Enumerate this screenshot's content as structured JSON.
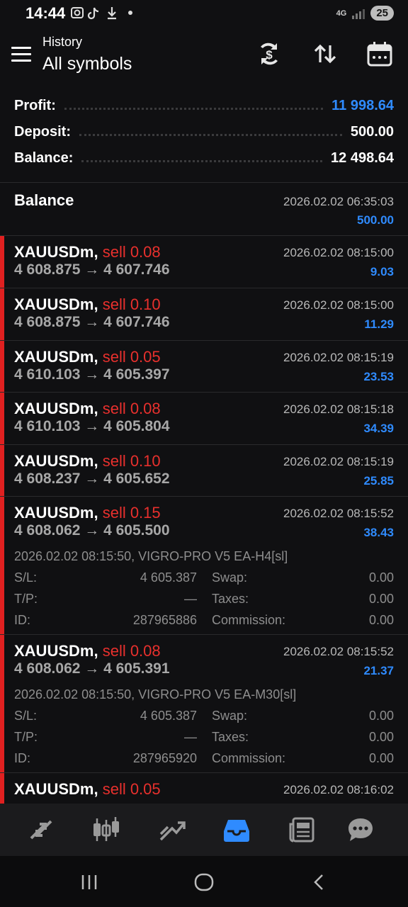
{
  "status": {
    "time": "14:44",
    "battery": "25",
    "network": "4G"
  },
  "header": {
    "subtitle": "History",
    "title": "All symbols"
  },
  "summary": [
    {
      "label": "Profit:",
      "value": "11 998.64",
      "color": "#2f8bff"
    },
    {
      "label": "Deposit:",
      "value": "500.00",
      "color": "#ffffff"
    },
    {
      "label": "Balance:",
      "value": "12 498.64",
      "color": "#ffffff"
    }
  ],
  "balance_entry": {
    "label": "Balance",
    "time": "2026.02.02 06:35:03",
    "amount": "500.00"
  },
  "deals": [
    {
      "symbol": "XAUUSDm,",
      "side": "sell 0.08",
      "prices": "4 608.875 → 4 607.746",
      "time": "2026.02.02 08:15:00",
      "profit": "9.03"
    },
    {
      "symbol": "XAUUSDm,",
      "side": "sell 0.10",
      "prices": "4 608.875 → 4 607.746",
      "time": "2026.02.02 08:15:00",
      "profit": "11.29"
    },
    {
      "symbol": "XAUUSDm,",
      "side": "sell 0.05",
      "prices": "4 610.103 → 4 605.397",
      "time": "2026.02.02 08:15:19",
      "profit": "23.53"
    },
    {
      "symbol": "XAUUSDm,",
      "side": "sell 0.08",
      "prices": "4 610.103 → 4 605.804",
      "time": "2026.02.02 08:15:18",
      "profit": "34.39"
    },
    {
      "symbol": "XAUUSDm,",
      "side": "sell 0.10",
      "prices": "4 608.237 → 4 605.652",
      "time": "2026.02.02 08:15:19",
      "profit": "25.85"
    },
    {
      "symbol": "XAUUSDm,",
      "side": "sell 0.15",
      "prices": "4 608.062 → 4 605.500",
      "time": "2026.02.02 08:15:52",
      "profit": "38.43",
      "details": {
        "comment": "2026.02.02 08:15:50, VIGRO-PRO V5 EA-H4[sl]",
        "sl_label": "S/L:",
        "sl": "4 605.387",
        "tp_label": "T/P:",
        "tp": "—",
        "id_label": "ID:",
        "id": "287965886",
        "swap_label": "Swap:",
        "swap": "0.00",
        "taxes_label": "Taxes:",
        "taxes": "0.00",
        "commission_label": "Commission:",
        "commission": "0.00"
      }
    },
    {
      "symbol": "XAUUSDm,",
      "side": "sell 0.08",
      "prices": "4 608.062 → 4 605.391",
      "time": "2026.02.02 08:15:52",
      "profit": "21.37",
      "details": {
        "comment": "2026.02.02 08:15:50, VIGRO-PRO V5 EA-M30[sl]",
        "sl_label": "S/L:",
        "sl": "4 605.387",
        "tp_label": "T/P:",
        "tp": "—",
        "id_label": "ID:",
        "id": "287965920",
        "swap_label": "Swap:",
        "swap": "0.00",
        "taxes_label": "Taxes:",
        "taxes": "0.00",
        "commission_label": "Commission:",
        "commission": "0.00"
      }
    },
    {
      "symbol": "XAUUSDm,",
      "side": "sell 0.05",
      "prices": "",
      "time": "2026.02.02 08:16:02",
      "profit": ""
    }
  ],
  "nav": {
    "items": [
      "quotes-icon",
      "chart-icon",
      "trade-icon",
      "history-icon",
      "news-icon",
      "chat-icon"
    ],
    "active": "history-icon",
    "active_color": "#2f8bff"
  }
}
